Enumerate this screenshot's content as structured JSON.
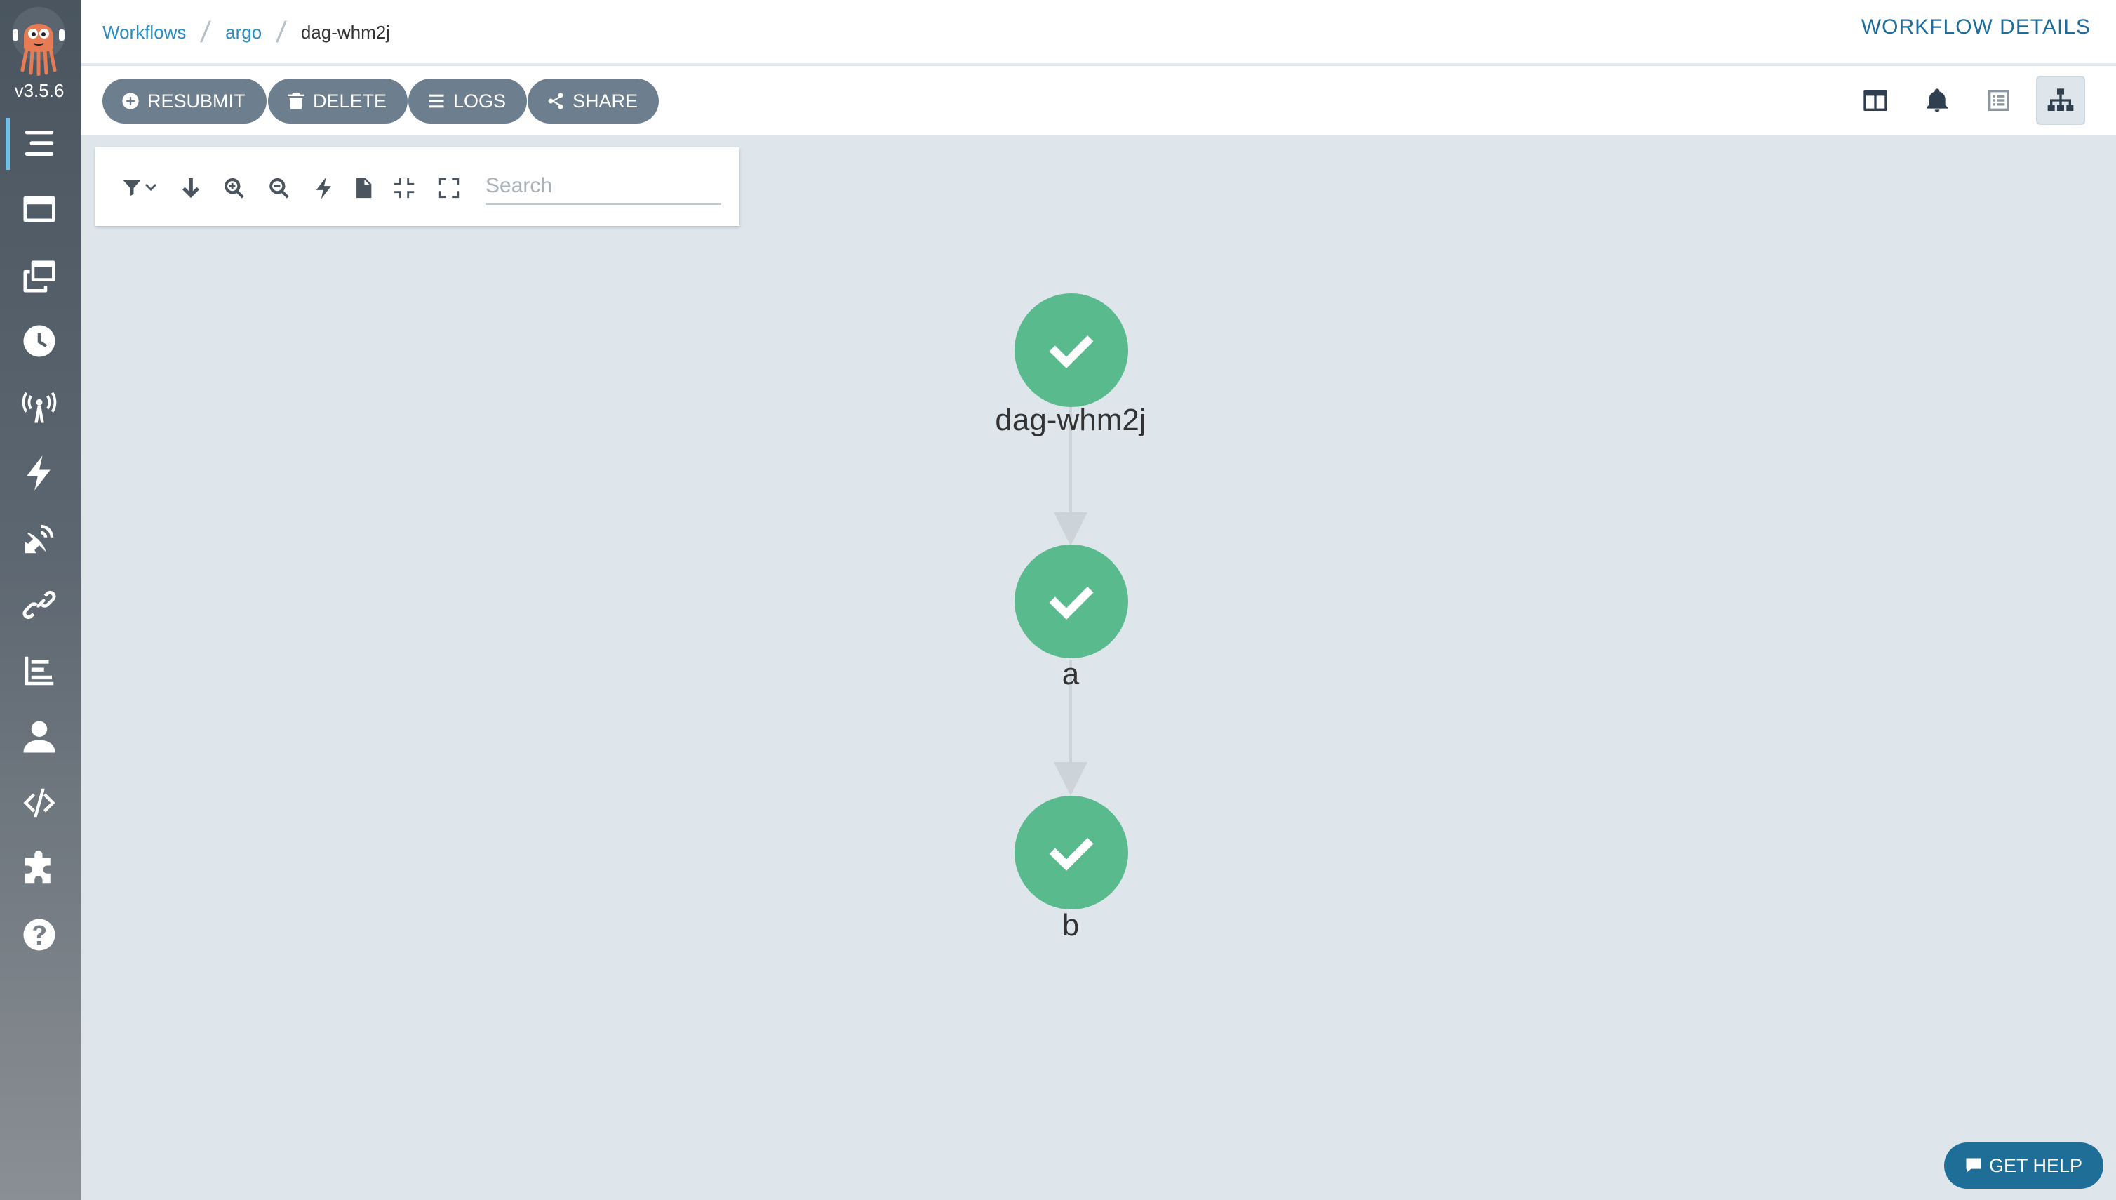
{
  "app": {
    "version": "v3.5.6"
  },
  "breadcrumb": {
    "items": [
      "Workflows",
      "argo"
    ],
    "current": "dag-whm2j"
  },
  "header": {
    "title": "WORKFLOW DETAILS"
  },
  "actions": {
    "resubmit": "RESUBMIT",
    "delete": "DELETE",
    "logs": "LOGS",
    "share": "SHARE"
  },
  "sidebar": {
    "items": [
      {
        "name": "workflows",
        "icon": "stream-icon"
      },
      {
        "name": "workflow-templates",
        "icon": "window-icon"
      },
      {
        "name": "cluster-workflow-templates",
        "icon": "clone-icon"
      },
      {
        "name": "cron-workflows",
        "icon": "clock-icon"
      },
      {
        "name": "event-sources",
        "icon": "broadcast-tower-icon"
      },
      {
        "name": "sensors",
        "icon": "bolt-icon"
      },
      {
        "name": "event-flow",
        "icon": "satellite-dish-icon"
      },
      {
        "name": "archived-workflows",
        "icon": "link-icon"
      },
      {
        "name": "reports",
        "icon": "chart-bar-icon"
      },
      {
        "name": "user",
        "icon": "user-icon"
      },
      {
        "name": "api-docs",
        "icon": "code-icon"
      },
      {
        "name": "plugins",
        "icon": "puzzle-piece-icon"
      },
      {
        "name": "help",
        "icon": "question-circle-icon"
      }
    ]
  },
  "graph_toolbar": {
    "search_placeholder": "Search"
  },
  "graph": {
    "nodes": [
      {
        "label": "dag-whm2j",
        "status": "succeeded"
      },
      {
        "label": "a",
        "status": "succeeded"
      },
      {
        "label": "b",
        "status": "succeeded"
      }
    ],
    "status_color": "#59ba8d"
  },
  "help": {
    "label": "GET HELP"
  },
  "colors": {
    "accent": "#2b8dc2",
    "button": "#6d7f8f",
    "help": "#1f6e98"
  }
}
